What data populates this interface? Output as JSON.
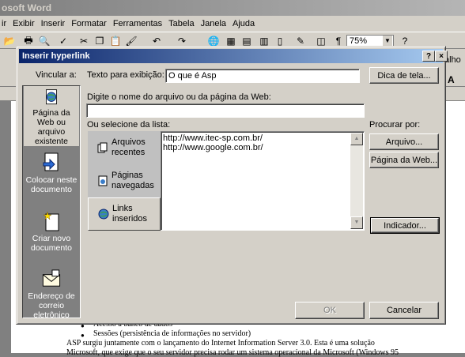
{
  "word": {
    "title": "osoft Word",
    "menu": [
      "ir",
      "Exibir",
      "Inserir",
      "Formatar",
      "Ferramentas",
      "Tabela",
      "Janela",
      "Ajuda"
    ],
    "zoom": "75%",
    "right_text": "alho",
    "right_a": "A"
  },
  "document": {
    "line1": "Acesso a banco de dados",
    "line2": "Sessões (persistência de informações no servidor)",
    "line3": "ASP surgiu juntamente com o lançamento do Internet Information Server 3.0. Esta é uma solução",
    "line4": "Microsoft, que exige que o seu servidor precisa rodar um sistema operacional da Microsoft (Windows 95"
  },
  "dialog": {
    "title": "Inserir hyperlink",
    "help_button": "?",
    "close_button": "×",
    "vincular_label": "Vincular a:",
    "display_text_label": "Texto para exibição:",
    "display_text_value": "O que é Asp",
    "screentip_button": "Dica de tela...",
    "address_label": "Digite o nome do arquivo ou da página da Web:",
    "address_value": "",
    "select_label": "Ou selecione da lista:",
    "browse_label": "Procurar por:",
    "file_button": "Arquivo...",
    "webpage_button": "Página da Web...",
    "bookmark_button": "Indicador...",
    "ok_button": "OK",
    "cancel_button": "Cancelar",
    "link_targets": [
      {
        "label": "Página da Web ou arquivo existente"
      },
      {
        "label": "Colocar neste documento"
      },
      {
        "label": "Criar novo documento"
      },
      {
        "label": "Endereço de correio eletrônico"
      }
    ],
    "list_sources": [
      {
        "label": "Arquivos recentes"
      },
      {
        "label": "Páginas navegadas"
      },
      {
        "label": "Links inseridos"
      }
    ],
    "urls": [
      "http://www.itec-sp.com.br/",
      "http://www.google.com.br/"
    ]
  }
}
